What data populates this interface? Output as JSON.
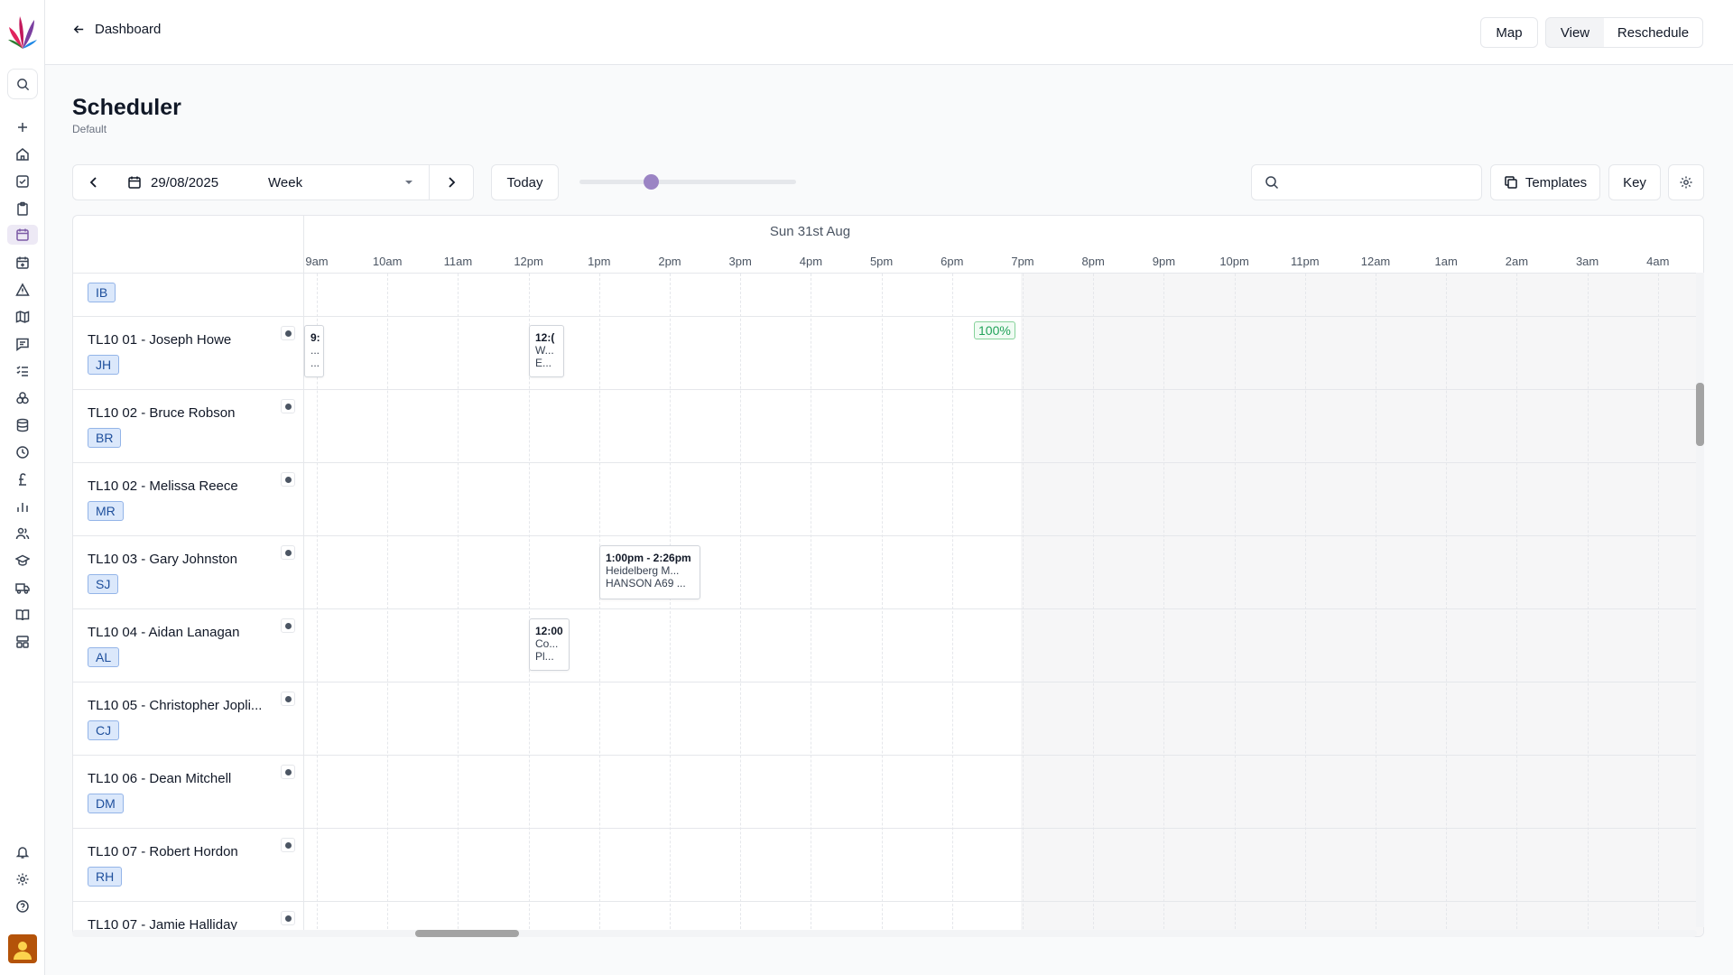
{
  "topbar": {
    "back_label": "Dashboard",
    "map_label": "Map",
    "view_label": "View",
    "reschedule_label": "Reschedule"
  },
  "page": {
    "title": "Scheduler",
    "subtitle": "Default"
  },
  "controls": {
    "date_value": "29/08/2025",
    "view_mode": "Week",
    "today_label": "Today",
    "zoom_level": 0.33,
    "search_placeholder": "",
    "templates_label": "Templates",
    "key_label": "Key"
  },
  "grid": {
    "day_label": "Sun 31st Aug",
    "hours": [
      "9am",
      "10am",
      "11am",
      "12pm",
      "1pm",
      "2pm",
      "3pm",
      "4pm",
      "5pm",
      "6pm",
      "7pm",
      "8pm",
      "9pm",
      "10pm",
      "11pm",
      "12am",
      "1am",
      "2am",
      "3am",
      "4am"
    ],
    "utilisation_badge": "100%",
    "rows": [
      {
        "name": "",
        "initials": "IB"
      },
      {
        "name": "TL10 01 - Joseph Howe",
        "initials": "JH"
      },
      {
        "name": "TL10 02 - Bruce Robson",
        "initials": "BR"
      },
      {
        "name": "TL10 02 - Melissa Reece",
        "initials": "MR"
      },
      {
        "name": "TL10 03 - Gary Johnston",
        "initials": "SJ"
      },
      {
        "name": "TL10 04 - Aidan Lanagan",
        "initials": "AL"
      },
      {
        "name": "TL10 05 - Christopher Jopli...",
        "initials": "CJ"
      },
      {
        "name": "TL10 06 - Dean Mitchell",
        "initials": "DM"
      },
      {
        "name": "TL10 07 - Robert Hordon",
        "initials": "RH"
      },
      {
        "name": "TL10 07 - Jamie Halliday",
        "initials": ""
      }
    ],
    "events": [
      {
        "lines": [
          "9:",
          "...",
          "..."
        ]
      },
      {
        "lines": [
          "12:(",
          "W...",
          "E..."
        ]
      },
      {
        "lines": [
          "1:00pm - 2:26pm",
          "Heidelberg M...",
          "HANSON A69 ..."
        ]
      },
      {
        "lines": [
          "12:00",
          "Co...",
          "Pl..."
        ]
      }
    ]
  },
  "colors": {
    "accent": "#9b84c4",
    "badge_bg": "#dbe8fb",
    "badge_text": "#1e4f9c",
    "success": "#22a35a"
  }
}
